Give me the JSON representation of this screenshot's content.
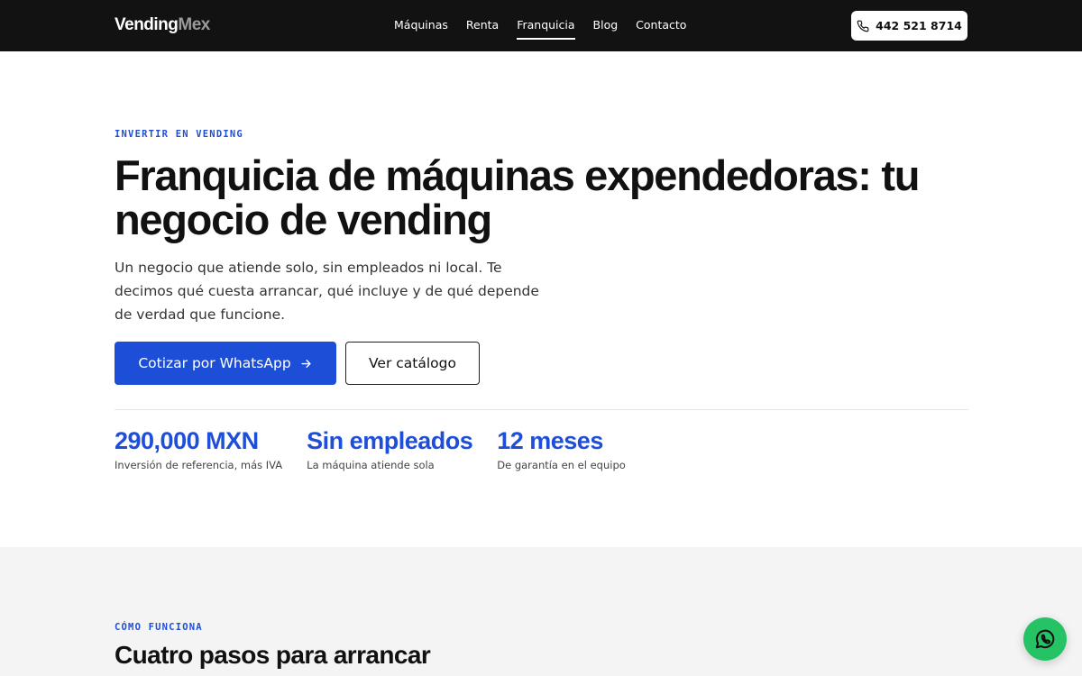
{
  "header": {
    "brand_primary": "Vending",
    "brand_secondary": "Mex",
    "nav": [
      {
        "label": "Máquinas",
        "active": false
      },
      {
        "label": "Renta",
        "active": false
      },
      {
        "label": "Franquicia",
        "active": true
      },
      {
        "label": "Blog",
        "active": false
      },
      {
        "label": "Contacto",
        "active": false
      }
    ],
    "phone_icon": "phone-icon",
    "phone_label": "442 521 8714"
  },
  "hero": {
    "eyebrow": "INVERTIR EN VENDING",
    "title": "Franquicia de máquinas expendedoras: tu negocio de vending",
    "subtitle": "Un negocio que atiende solo, sin empleados ni local. Te decimos qué cuesta arrancar, qué incluye y de qué depende de verdad que funcione.",
    "cta_primary": "Cotizar por WhatsApp",
    "cta_primary_icon": "arrow-right-icon",
    "cta_secondary": "Ver catálogo",
    "stats": [
      {
        "value": "290,000 MXN",
        "label": "Inversión de referencia, más IVA"
      },
      {
        "value": "Sin empleados",
        "label": "La máquina atiende sola"
      },
      {
        "value": "12 meses",
        "label": "De garantía en el equipo"
      }
    ]
  },
  "how": {
    "eyebrow": "CÓMO FUNCIONA",
    "title": "Cuatro pasos para arrancar"
  },
  "fab": {
    "icon": "whatsapp-icon"
  },
  "colors": {
    "header_bg": "#121212",
    "accent": "#1d4ed8",
    "section_bg": "#f4f4f4",
    "whatsapp": "#25c366"
  }
}
